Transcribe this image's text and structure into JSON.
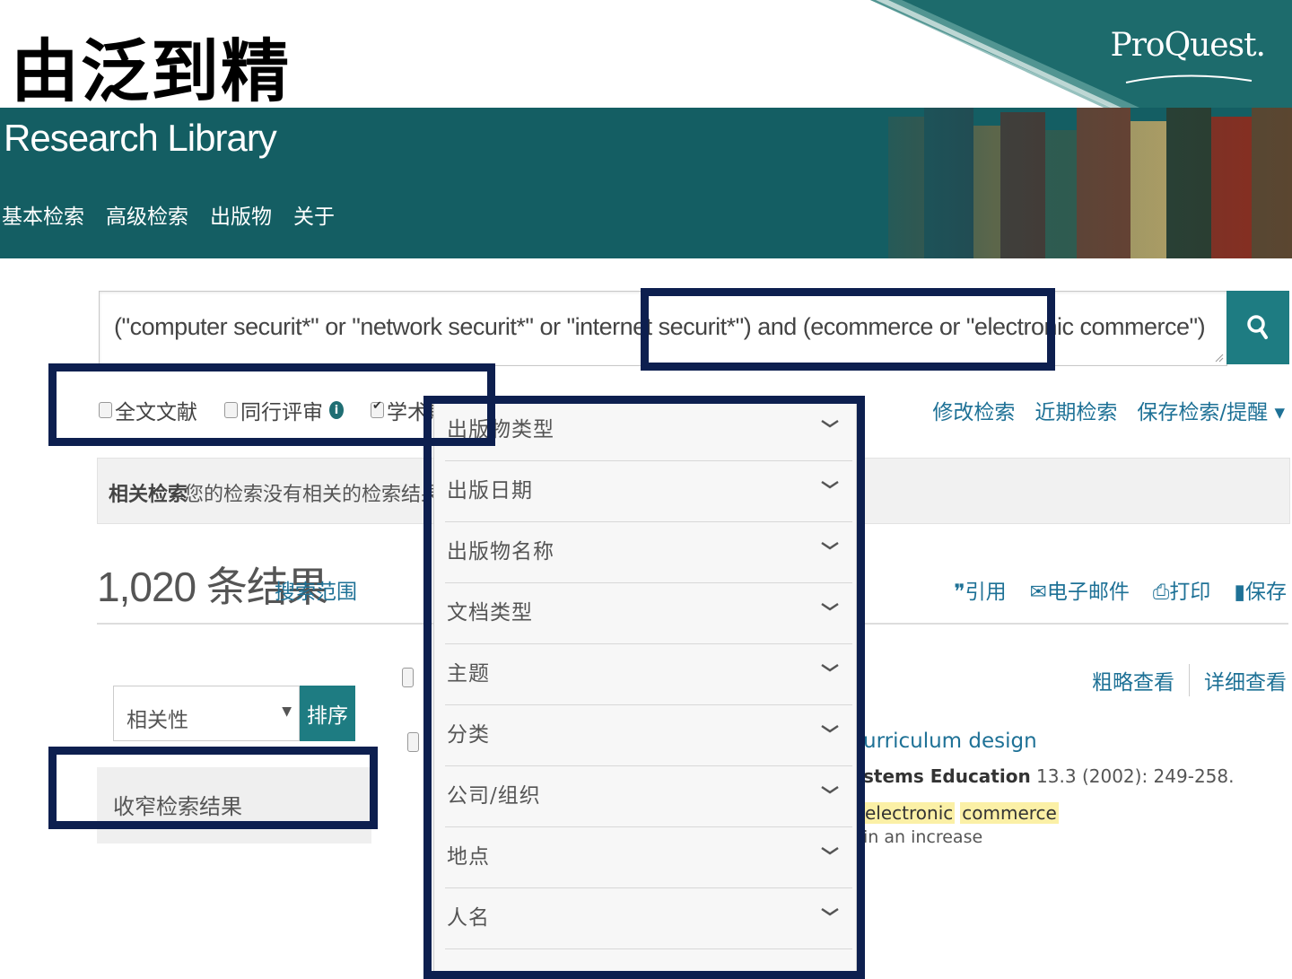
{
  "slide": {
    "title": "由泛到精"
  },
  "brand": {
    "logo_text": "ProQuest."
  },
  "banner": {
    "title": "Research Library",
    "nav": [
      "基本检索",
      "高级检索",
      "出版物",
      "关于"
    ]
  },
  "search": {
    "query": "(\"computer securit*\" or \"network securit*\" or \"internet securit*\") and (ecommerce or \"electronic commerce\")",
    "button_icon": "search-icon"
  },
  "filters": {
    "items": [
      {
        "label": "全文文献",
        "checked": false,
        "info": false
      },
      {
        "label": "同行评审",
        "checked": false,
        "info": true
      },
      {
        "label": "学术期刊",
        "checked": true,
        "info": true
      }
    ]
  },
  "top_links": [
    "修改检索",
    "近期检索",
    "保存检索/提醒 ▾"
  ],
  "related": {
    "label": "相关检索",
    "text": "您的检索没有相关的检索结果。"
  },
  "results": {
    "count": "1,020 条结果",
    "scope_link": "搜索范围",
    "actions": [
      {
        "icon": "quote-icon",
        "glyph": "❞",
        "label": "引用"
      },
      {
        "icon": "email-icon",
        "glyph": "✉",
        "label": "电子邮件"
      },
      {
        "icon": "print-icon",
        "glyph": "⎙",
        "label": "打印"
      },
      {
        "icon": "save-icon",
        "glyph": "▮",
        "label": "保存"
      }
    ]
  },
  "sort": {
    "selected": "相关性",
    "button": "排序"
  },
  "narrow": {
    "label": "收窄检索结果"
  },
  "view": {
    "brief": "粗略查看",
    "detailed": "详细查看"
  },
  "result_partial": {
    "title": "urriculum design",
    "source_bold": "stems Education",
    "source_rest": " 13.3 (2002): 249-258.",
    "highlights": [
      "electronic",
      "commerce"
    ],
    "snippet": "in an increase"
  },
  "facets": {
    "items": [
      "出版物类型",
      "出版日期",
      "出版物名称",
      "文档类型",
      "主题",
      "分类",
      "公司/组织",
      "地点",
      "人名"
    ]
  },
  "colors": {
    "banner": "#145e63",
    "accent_button": "#1e7c82",
    "link": "#1e7196",
    "annotation_border": "#0d1f4f",
    "highlight": "#fbf0a6"
  }
}
